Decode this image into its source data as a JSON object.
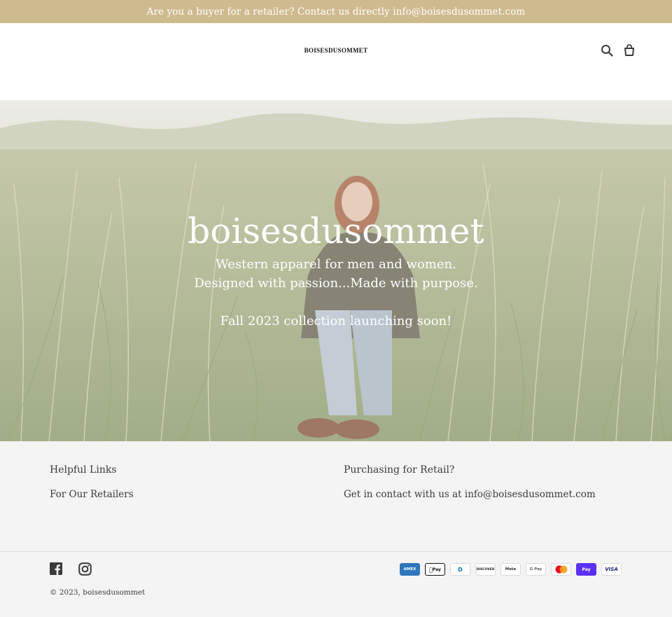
{
  "announcement": {
    "text": "Are you a buyer for a retailer? Contact us directly info@boisesdusommet.com"
  },
  "header": {
    "logo": "BOISESDUSOMMET",
    "icons": {
      "search": "search-icon",
      "cart": "cart-icon"
    }
  },
  "hero": {
    "title": "boisesdusommet",
    "line1": "Western apparel for men and women.",
    "line2": "Designed with passion...Made with purpose.",
    "line3": "Fall 2023 collection launching soon!"
  },
  "footer": {
    "helpful_links": {
      "title": "Helpful Links",
      "items": [
        "For Our Retailers"
      ]
    },
    "retail": {
      "title": "Purchasing for Retail?",
      "body": "Get in contact with us at info@boisesdusommet.com"
    },
    "social": [
      "facebook-icon",
      "instagram-icon"
    ],
    "payments": {
      "amex": "AMEX",
      "apple": "Pay",
      "diners": "D",
      "discover": "DISCOVER",
      "meta": "Meta",
      "gpay": "G Pay",
      "mastercard": "mastercard-icon",
      "shop": "Pay",
      "visa": "VISA"
    },
    "copyright": "© 2023, boisesdusommet"
  },
  "colors": {
    "announcement_bg": "#cfba8f",
    "footer_bg": "#f4f4f4",
    "text": "#3a3a3a"
  }
}
